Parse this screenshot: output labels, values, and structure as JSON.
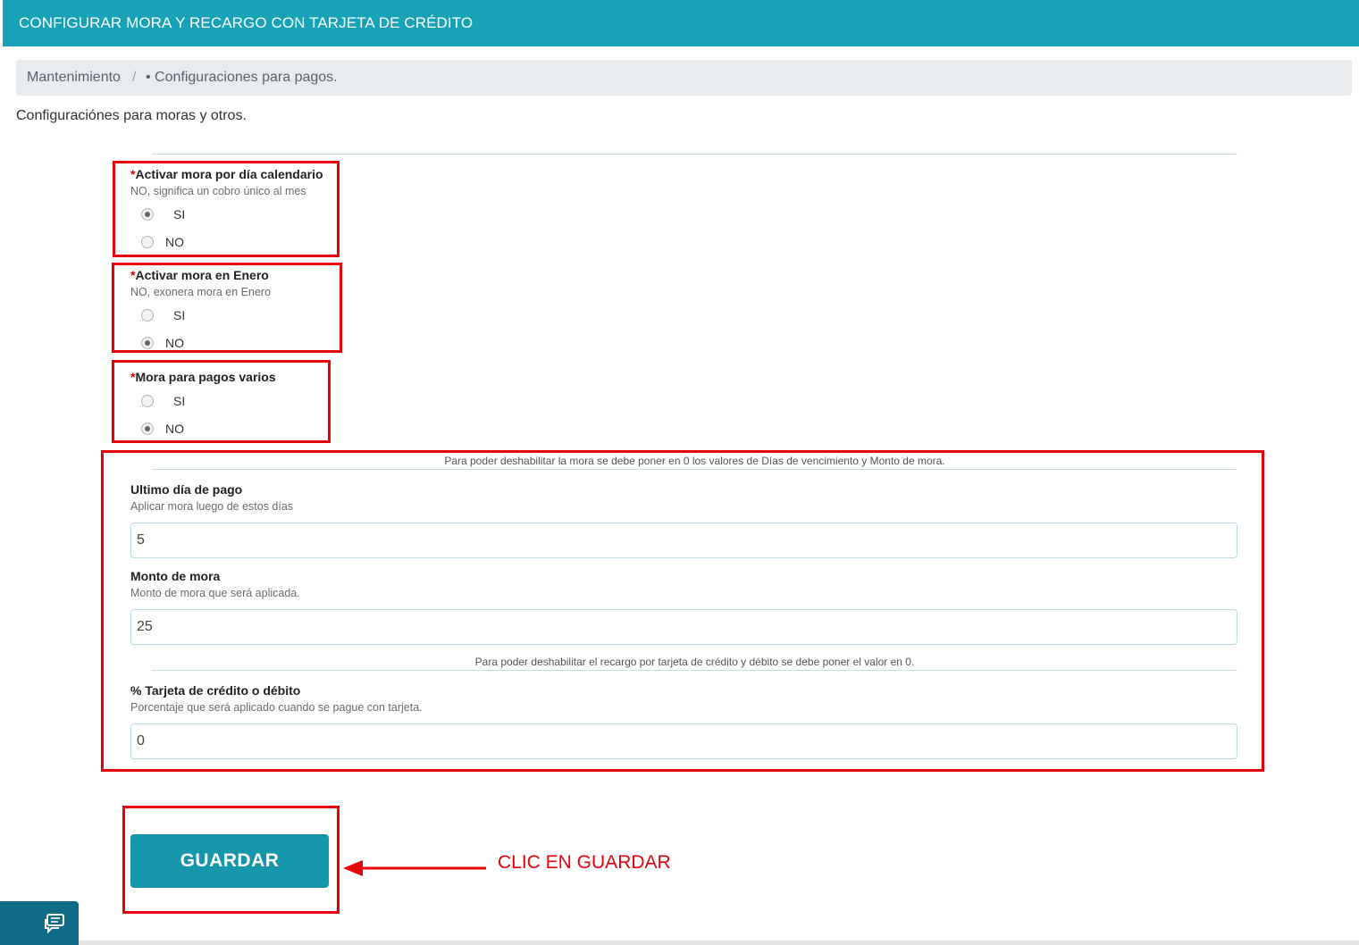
{
  "header": {
    "title": "CONFIGURAR MORA Y RECARGO CON TARJETA DE CRÉDITO",
    "color": "#17a2b8"
  },
  "breadcrumb": {
    "item1": "Mantenimiento",
    "separator": "/",
    "item2": "• Configuraciones para pagos."
  },
  "intro": "Configuraciónes para moras y otros.",
  "required_mark": "*",
  "section_calendario": {
    "label": "Activar mora por día calendario",
    "help": "NO, significa un cobro único al mes",
    "options": [
      {
        "label": "SI",
        "checked": true
      },
      {
        "label": "NO",
        "checked": false
      }
    ]
  },
  "section_enero": {
    "label": "Activar mora en Enero",
    "help": "NO, exonera mora en Enero",
    "options": [
      {
        "label": "SI",
        "checked": false
      },
      {
        "label": "NO",
        "checked": true
      }
    ]
  },
  "section_varios": {
    "label": "Mora para pagos varios",
    "options": [
      {
        "label": "SI",
        "checked": false
      },
      {
        "label": "NO",
        "checked": true
      }
    ]
  },
  "note_mora": "Para poder deshabilitar la mora se debe poner en 0 los valores de Días de vencimiento y Monto de mora.",
  "field_ultimo_dia": {
    "label": "Ultimo día de pago",
    "help": "Aplicar mora luego de estos días",
    "value": "5"
  },
  "field_monto": {
    "label": "Monto de mora",
    "help": "Monto de mora que será aplicada.",
    "value": "25"
  },
  "note_recargo": "Para poder deshabilitar el recargo por tarjeta de crédito y débito se debe poner el valor en 0.",
  "field_tarjeta": {
    "label": "% Tarjeta de crédito o débito",
    "help": "Porcentaje que será aplicado cuando se pague con tarjeta.",
    "value": "0"
  },
  "save_button": {
    "label": "GUARDAR",
    "color": "#1596aa"
  },
  "annotation": {
    "text": "CLIC EN GUARDAR",
    "color": "#e8000b"
  },
  "chat_widget": {
    "icon": "chat-icon"
  }
}
